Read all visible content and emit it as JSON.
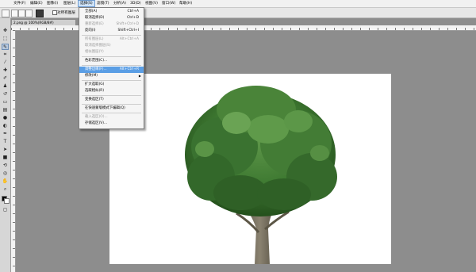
{
  "menubar": {
    "items": [
      {
        "label": "文件(F)"
      },
      {
        "label": "编辑(E)"
      },
      {
        "label": "图像(I)"
      },
      {
        "label": "图层(L)"
      },
      {
        "label": "选择(S)"
      },
      {
        "label": "滤镜(T)"
      },
      {
        "label": "分析(A)"
      },
      {
        "label": "3D(D)"
      },
      {
        "label": "视图(V)"
      },
      {
        "label": "窗口(W)"
      },
      {
        "label": "帮助(H)"
      }
    ]
  },
  "options": {
    "auto_enhance_label": "对所有图层"
  },
  "document": {
    "tab_label": "2.png @ 100%(RGB/8#)"
  },
  "select_menu": {
    "items": [
      {
        "label": "全部(A)",
        "shortcut": "Ctrl+A",
        "enabled": true
      },
      {
        "label": "取消选择(D)",
        "shortcut": "Ctrl+D",
        "enabled": true
      },
      {
        "label": "重新选择(E)",
        "shortcut": "Shift+Ctrl+D",
        "enabled": false
      },
      {
        "label": "反向(I)",
        "shortcut": "Shift+Ctrl+I",
        "enabled": true
      },
      {
        "label": "所有图层(L)",
        "shortcut": "Alt+Ctrl+A",
        "enabled": false
      },
      {
        "label": "取消选择图层(S)",
        "shortcut": "",
        "enabled": false
      },
      {
        "label": "相似图层(Y)",
        "shortcut": "",
        "enabled": false
      },
      {
        "label": "色彩范围(C)...",
        "shortcut": "",
        "enabled": true
      },
      {
        "label": "调整边缘(F)...",
        "shortcut": "Alt+Ctrl+R",
        "enabled": true,
        "highlighted": true
      },
      {
        "label": "修改(M)",
        "shortcut": "",
        "enabled": true,
        "submenu": true
      },
      {
        "label": "扩大选取(G)",
        "shortcut": "",
        "enabled": true
      },
      {
        "label": "选取相似(R)",
        "shortcut": "",
        "enabled": true
      },
      {
        "label": "变换选区(T)",
        "shortcut": "",
        "enabled": true
      },
      {
        "label": "在快速蒙版模式下编辑(Q)",
        "shortcut": "",
        "enabled": true
      },
      {
        "label": "载入选区(O)...",
        "shortcut": "",
        "enabled": false
      },
      {
        "label": "存储选区(V)...",
        "shortcut": "",
        "enabled": true
      }
    ]
  },
  "colors": {
    "workspace": "#8d8d8d",
    "canvas": "#ffffff",
    "menu_highlight": "#5a9ee5",
    "tree_foliage": "#3f7a32"
  },
  "icons": {
    "menu_submenu_arrow": "triangle-right-icon",
    "tools": [
      "move-icon",
      "marquee-icon",
      "lasso-icon",
      "quick-selection-icon",
      "crop-icon",
      "eyedropper-icon",
      "healing-brush-icon",
      "brush-icon",
      "clone-stamp-icon",
      "history-brush-icon",
      "eraser-icon",
      "gradient-icon",
      "blur-icon",
      "dodge-icon",
      "pen-icon",
      "type-icon",
      "path-selection-icon",
      "shape-icon",
      "3d-rotate-icon",
      "3d-orbit-icon",
      "hand-icon",
      "zoom-icon"
    ]
  }
}
